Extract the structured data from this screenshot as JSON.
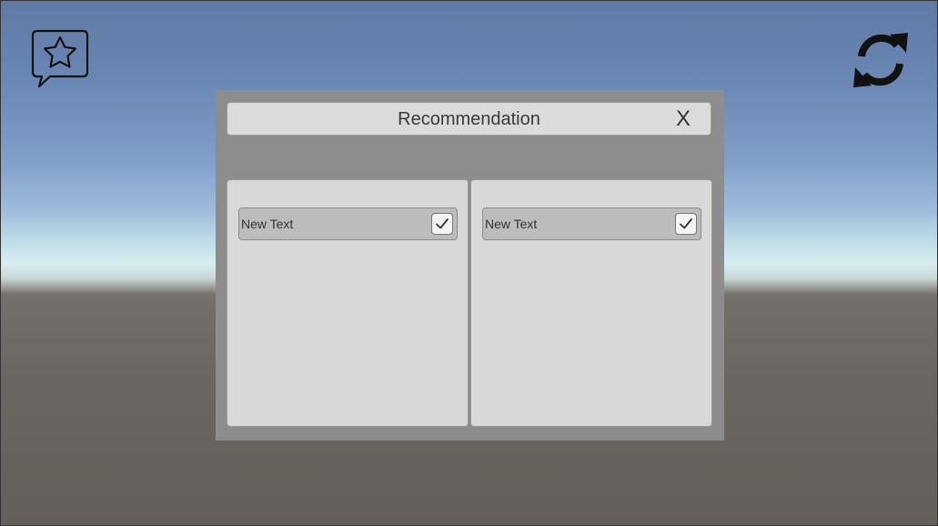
{
  "icons": {
    "favorite": "star-speech-bubble-icon",
    "refresh": "refresh-icon",
    "close": "close-icon",
    "check": "checkmark-icon"
  },
  "dialog": {
    "title": "Recommendation",
    "close_label": "X",
    "panels": [
      {
        "items": [
          {
            "label": "New Text",
            "checked": true
          }
        ]
      },
      {
        "items": [
          {
            "label": "New Text",
            "checked": true
          }
        ]
      }
    ]
  },
  "colors": {
    "dialog_bg": "#8d8d8d",
    "panel_bg": "#d8d8d8",
    "item_bg": "#bcbcbc"
  }
}
